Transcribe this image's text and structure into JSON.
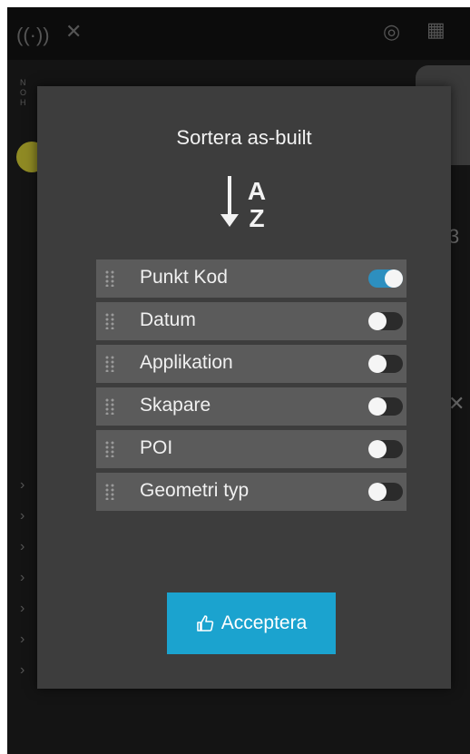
{
  "dialog": {
    "title": "Sortera as-built",
    "sort_icon": "sort-alphabetical-descending-icon",
    "items": [
      {
        "label": "Punkt Kod",
        "enabled": true
      },
      {
        "label": "Datum",
        "enabled": false
      },
      {
        "label": "Applikation",
        "enabled": false
      },
      {
        "label": "Skapare",
        "enabled": false
      },
      {
        "label": "POI",
        "enabled": false
      },
      {
        "label": "Geometri typ",
        "enabled": false
      }
    ],
    "accept_label": "Acceptera",
    "accept_icon": "thumbs-up-icon"
  },
  "colors": {
    "accent": "#1ba3cf",
    "toggle_on": "#2d8fbf",
    "dialog_bg": "#3d3d3d",
    "row_bg": "#5b5b5b"
  }
}
